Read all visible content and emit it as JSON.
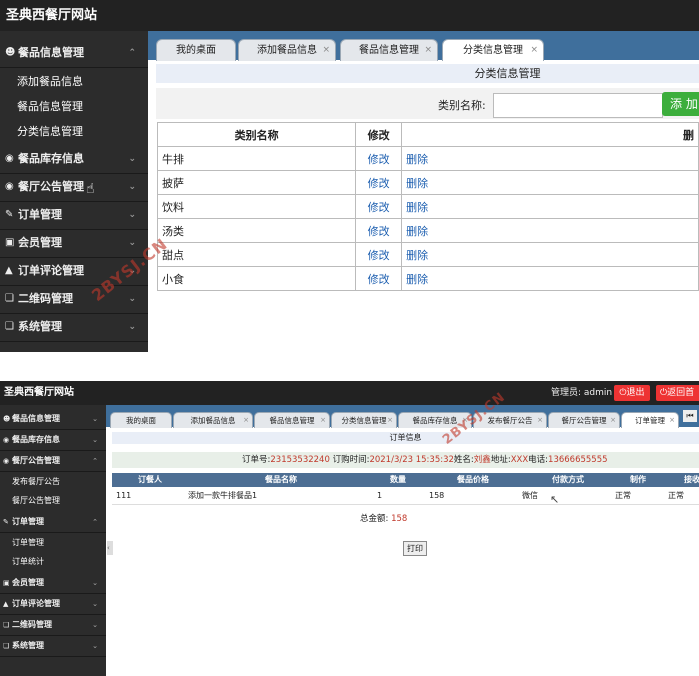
{
  "top": {
    "app_title": "圣典西餐厅网站",
    "sidebar": {
      "groups": [
        {
          "label": "餐品信息管理",
          "icon": "user-icon",
          "chevron": "up-chevron-icon"
        },
        {
          "label": "餐品库存信息",
          "icon": "chat-icon",
          "chevron": "down-chevron-icon"
        },
        {
          "label": "餐厅公告管理",
          "icon": "chat-icon",
          "chevron": "down-chevron-icon"
        },
        {
          "label": "订单管理",
          "icon": "edit-icon",
          "chevron": "down-chevron-icon"
        },
        {
          "label": "会员管理",
          "icon": "image-icon",
          "chevron": "down-chevron-icon"
        },
        {
          "label": "订单评论管理",
          "icon": "flask-icon",
          "chevron": "down-chevron-icon"
        },
        {
          "label": "二维码管理",
          "icon": "copy-icon",
          "chevron": "down-chevron-icon"
        },
        {
          "label": "系统管理",
          "icon": "copy-icon",
          "chevron": "down-chevron-icon"
        }
      ],
      "subitems": [
        "添加餐品信息",
        "餐品信息管理",
        "分类信息管理"
      ]
    },
    "tabs": [
      "我的桌面",
      "添加餐品信息",
      "餐品信息管理",
      "分类信息管理"
    ],
    "close_glyph": "×",
    "crumb": "分类信息管理",
    "search_label": "类别名称:",
    "search_value": "",
    "add_label": "添 加",
    "table": {
      "headers": [
        "类别名称",
        "修改",
        "删"
      ],
      "rows": [
        {
          "name": "牛排",
          "edit": "修改",
          "del": "删除"
        },
        {
          "name": "披萨",
          "edit": "修改",
          "del": "删除"
        },
        {
          "name": "饮料",
          "edit": "修改",
          "del": "删除"
        },
        {
          "name": "汤类",
          "edit": "修改",
          "del": "删除"
        },
        {
          "name": "甜点",
          "edit": "修改",
          "del": "删除"
        },
        {
          "name": "小食",
          "edit": "修改",
          "del": "删除"
        }
      ]
    },
    "watermark": "2BYSJ.CN"
  },
  "bottom": {
    "app_title": "圣典西餐厅网站",
    "admin_label": "管理员: admin",
    "logout_label": "退出",
    "back_label": "返回首",
    "sidebar": {
      "groups": [
        {
          "label": "餐品信息管理",
          "icon": "user-icon"
        },
        {
          "label": "餐品库存信息",
          "icon": "chat-icon"
        },
        {
          "label": "餐厅公告管理",
          "icon": "chat-icon"
        },
        {
          "label": "订单管理",
          "icon": "edit-icon"
        },
        {
          "label": "会员管理",
          "icon": "image-icon"
        },
        {
          "label": "订单评论管理",
          "icon": "flask-icon"
        },
        {
          "label": "二维码管理",
          "icon": "copy-icon"
        },
        {
          "label": "系统管理",
          "icon": "copy-icon"
        }
      ],
      "notice_subitems": [
        "发布餐厅公告",
        "餐厅公告管理"
      ],
      "order_subitems": [
        "订单管理",
        "订单统计"
      ]
    },
    "tabs": [
      "我的桌面",
      "添加餐品信息",
      "餐品信息管理",
      "分类信息管理",
      "餐品库存信息",
      "发布餐厅公告",
      "餐厅公告管理",
      "订单管理"
    ],
    "close_glyph": "×",
    "collapse_glyph": "⏮",
    "crumb": "订单信息",
    "order": {
      "no_label": "订单号:",
      "no_value": "23153532240",
      "time_label": "订购时间:",
      "time_value": "2021/3/23 15:35:32",
      "name_label": "姓名:",
      "name_value": "刘鑫",
      "addr_label": "地址:",
      "addr_value": "XXX",
      "phone_label": "电话:",
      "phone_value": "13666655555"
    },
    "table": {
      "headers": [
        "订餐人",
        "餐品名称",
        "数量",
        "餐品价格",
        "付款方式",
        "制作",
        "接收"
      ],
      "row": [
        "111",
        "添加一款牛排餐品1",
        "1",
        "158",
        "微信",
        "正常",
        "正常"
      ]
    },
    "total_label": "总金额:",
    "total_value": "158",
    "print_label": "打印",
    "watermark": "2BYSJ.CN"
  }
}
